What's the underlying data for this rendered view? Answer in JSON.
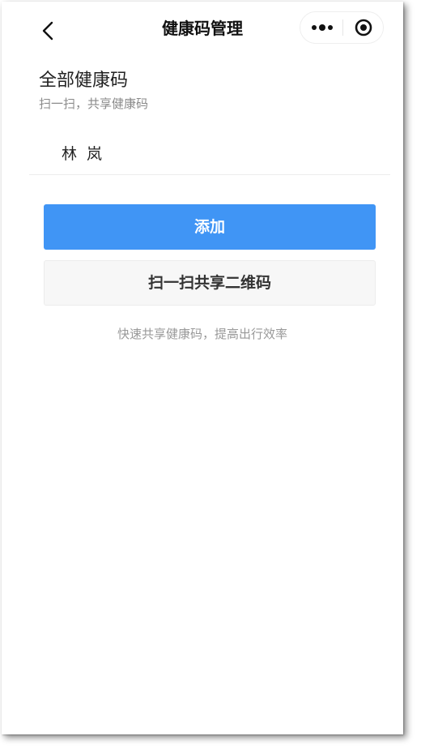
{
  "nav": {
    "title": "健康码管理",
    "back_icon": "chevron-left-icon",
    "more_icon": "more-dots-icon",
    "close_icon": "target-circle-icon"
  },
  "section": {
    "title": "全部健康码",
    "subtitle": "扫一扫，共享健康码"
  },
  "codes": [
    {
      "name": "林 岚"
    }
  ],
  "actions": {
    "add_label": "添加",
    "scan_label": "扫一扫共享二维码"
  },
  "hint": "快速共享健康码，提高出行效率",
  "colors": {
    "primary": "#4095f5",
    "secondary_bg": "#f7f7f7",
    "muted_text": "#999999"
  }
}
